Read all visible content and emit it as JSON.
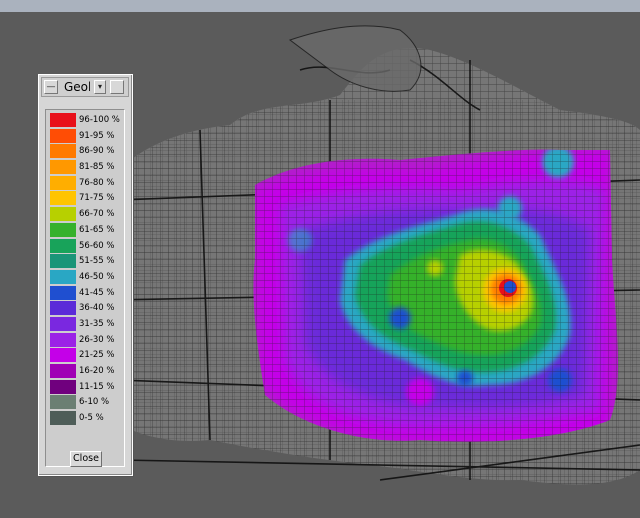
{
  "window": {
    "title": "Geol",
    "close_label": "Close",
    "minimize_icon": "window-minimize-icon",
    "menu_icon": "window-menu-icon",
    "maximize_icon": "window-maximize-icon"
  },
  "legend": {
    "items": [
      {
        "label": "96-100 %",
        "color": "#e8101a"
      },
      {
        "label": "91-95 %",
        "color": "#ff4d05"
      },
      {
        "label": "86-90 %",
        "color": "#ff7a00"
      },
      {
        "label": "81-85 %",
        "color": "#ff9800"
      },
      {
        "label": "76-80 %",
        "color": "#ffae00"
      },
      {
        "label": "71-75 %",
        "color": "#ffc400"
      },
      {
        "label": "66-70 %",
        "color": "#b7d000"
      },
      {
        "label": "61-65 %",
        "color": "#36b12c"
      },
      {
        "label": "56-60 %",
        "color": "#18a35a"
      },
      {
        "label": "51-55 %",
        "color": "#1a9578"
      },
      {
        "label": "46-50 %",
        "color": "#29a7c4"
      },
      {
        "label": "41-45 %",
        "color": "#1f4fd0"
      },
      {
        "label": "36-40 %",
        "color": "#5b2bd8"
      },
      {
        "label": "31-35 %",
        "color": "#7a28e0"
      },
      {
        "label": "26-30 %",
        "color": "#9b22e6"
      },
      {
        "label": "21-25 %",
        "color": "#c400e8"
      },
      {
        "label": "16-20 %",
        "color": "#a000b5"
      },
      {
        "label": "11-15 %",
        "color": "#70007e"
      },
      {
        "label": "6-10 %",
        "color": "#6b7f73"
      },
      {
        "label": "0-5 %",
        "color": "#4e5d58"
      }
    ]
  },
  "map": {
    "background": "#5b5b5b",
    "land_color": "#757575",
    "street_color": "#1b1b1b"
  }
}
